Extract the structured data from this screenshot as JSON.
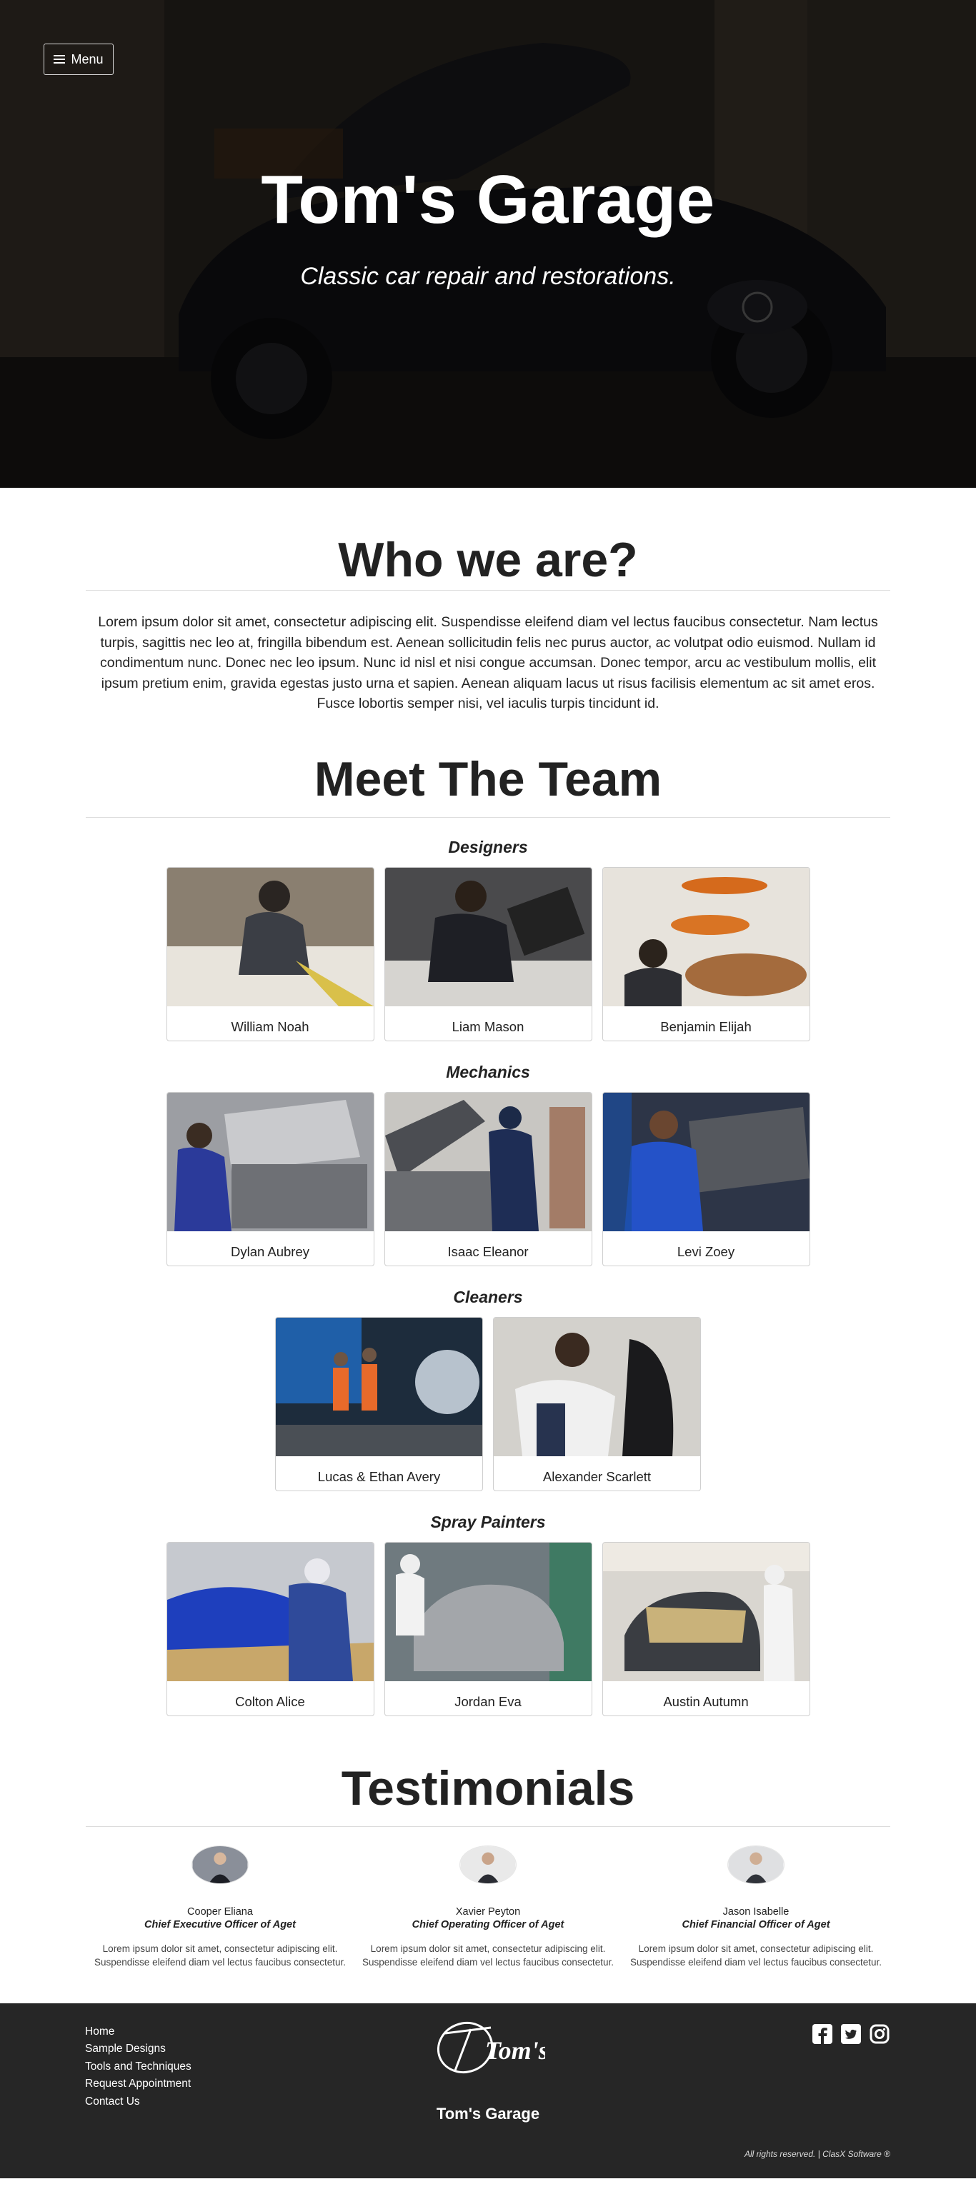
{
  "hero": {
    "menu_label": "Menu",
    "title": "Tom's Garage",
    "subtitle": "Classic car repair and restorations."
  },
  "about": {
    "title": "Who we are?",
    "text": "Lorem ipsum dolor sit amet, consectetur adipiscing elit. Suspendisse eleifend diam vel lectus faucibus consectetur. Nam lectus turpis, sagittis nec leo at, fringilla bibendum est. Aenean sollicitudin felis nec purus auctor, ac volutpat odio euismod. Nullam id condimentum nunc. Donec nec leo ipsum. Nunc id nisl et nisi congue accumsan. Donec tempor, arcu ac vestibulum mollis, elit ipsum pretium enim, gravida egestas justo urna et sapien. Aenean aliquam lacus ut risus facilisis elementum ac sit amet eros. Fusce lobortis semper nisi, vel iaculis turpis tincidunt id."
  },
  "team": {
    "title": "Meet The Team",
    "groups": [
      {
        "title": "Designers",
        "members": [
          "William Noah",
          "Liam Mason",
          "Benjamin Elijah"
        ]
      },
      {
        "title": "Mechanics",
        "members": [
          "Dylan Aubrey",
          "Isaac Eleanor",
          "Levi Zoey"
        ]
      },
      {
        "title": "Cleaners",
        "members": [
          "Lucas & Ethan Avery",
          "Alexander Scarlett"
        ]
      },
      {
        "title": "Spray Painters",
        "members": [
          "Colton Alice",
          "Jordan Eva",
          "Austin Autumn"
        ]
      }
    ]
  },
  "testimonials": {
    "title": "Testimonials",
    "items": [
      {
        "name": "Cooper Eliana",
        "role": "Chief Executive Officer of Aget",
        "text": "Lorem ipsum dolor sit amet, consectetur adipiscing elit. Suspendisse eleifend diam vel lectus faucibus consectetur."
      },
      {
        "name": "Xavier Peyton",
        "role": "Chief Operating Officer of Aget",
        "text": "Lorem ipsum dolor sit amet, consectetur adipiscing elit. Suspendisse eleifend diam vel lectus faucibus consectetur."
      },
      {
        "name": "Jason Isabelle",
        "role": "Chief Financial Officer of Aget",
        "text": "Lorem ipsum dolor sit amet, consectetur adipiscing elit. Suspendisse eleifend diam vel lectus faucibus consectetur."
      }
    ]
  },
  "footer": {
    "nav": [
      "Home",
      "Sample Designs",
      "Tools and Techniques",
      "Request Appointment",
      "Contact Us"
    ],
    "logo_text": "Tom's",
    "brand_name": "Tom's Garage",
    "social_icons": [
      "facebook-icon",
      "twitter-icon",
      "instagram-icon"
    ],
    "copyright": "All rights reserved. | ClasX Software ®"
  },
  "colors": {
    "footer_bg": "#262626",
    "hero_dark": "#1d1a17",
    "text": "#222222",
    "rule": "#dcdcdc"
  }
}
